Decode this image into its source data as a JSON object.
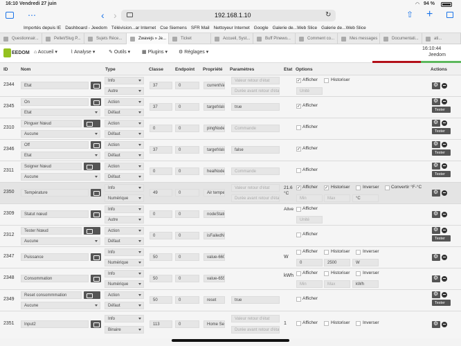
{
  "status": {
    "time": "16:10",
    "date": "Vendredi 27 juin",
    "battery": "94 %"
  },
  "url": {
    "text": "192.168.1.10"
  },
  "bookmarks": [
    "Importés depuis IE",
    "Dashboard - Jeedom",
    "Télévision...ar Internet",
    "Cse Siemens",
    "SFR Mail",
    "Nettoyeur Internet",
    "Google",
    "Galerie de...Web Slice",
    "Galerie de...Web Slice"
  ],
  "tabs": [
    "Questionnair...",
    "Pellet/Slug P...",
    "Sujets Réce...",
    "Zwavejs » Je...",
    "Ticket",
    "Accueil, Syst...",
    "Buff Pinewo...",
    "Comment co...",
    "Mes messages",
    "Documentati...",
    "ati..."
  ],
  "nav": {
    "logo": "EEDOM",
    "accueil": "Accueil",
    "analyse": "Analyse",
    "outils": "Outils",
    "plugins": "Plugins",
    "reglages": "Réglages",
    "clock": "16:10:44",
    "brand": "Jeedom"
  },
  "headers": {
    "id": "ID",
    "nom": "Nom",
    "type": "Type",
    "classe": "Classe",
    "endpoint": "Endpoint",
    "propriete": "Propriété",
    "parametres": "Paramètres",
    "etat": "Etat",
    "options": "Options",
    "actions": "Actions"
  },
  "labels": {
    "afficher": "Afficher",
    "historiser": "Historiser",
    "inverser": "Inverser",
    "convertir": "Convertir °F-°C",
    "tester": "Tester",
    "valeur": "Valeur retour d'état",
    "duree": "Durée avant retour d'état",
    "commande": "Commande",
    "unite": "Unité",
    "min": "Min",
    "max": "Max"
  },
  "rows": [
    {
      "id": "2344",
      "nom": "Etat",
      "t1": "Info",
      "t2": "Autre",
      "classe": "37",
      "endpoint": "0",
      "prop": "currentVa",
      "p1": "",
      "p2": "",
      "etat": "",
      "min": "",
      "max": "",
      "unit": "Unité"
    },
    {
      "id": "2345",
      "nom": "On",
      "sub": "Etat",
      "t1": "Action",
      "t2": "Défaut",
      "classe": "37",
      "endpoint": "0",
      "prop": "targetValu",
      "p1": "true",
      "etat": ""
    },
    {
      "id": "2310",
      "nom": "Pinguer Nœud",
      "sub": "Aucune",
      "t1": "Action",
      "t2": "Défaut",
      "classe": "0",
      "endpoint": "0",
      "prop": "pingNode",
      "p1": "",
      "etat": ""
    },
    {
      "id": "2346",
      "nom": "Off",
      "sub": "Etat",
      "t1": "Action",
      "t2": "Défaut",
      "classe": "37",
      "endpoint": "0",
      "prop": "targetValu",
      "p1": "false",
      "etat": ""
    },
    {
      "id": "2311",
      "nom": "Soigner Nœud",
      "sub": "Aucune",
      "t1": "Action",
      "t2": "Défaut",
      "classe": "0",
      "endpoint": "0",
      "prop": "healNode",
      "p1": "",
      "etat": ""
    },
    {
      "id": "2350",
      "nom": "Température",
      "t1": "Info",
      "t2": "Numérique",
      "classe": "49",
      "endpoint": "0",
      "prop": "Air tempe",
      "etat": "21.6 °C",
      "min": "Min",
      "max": "Max",
      "unit": "°C"
    },
    {
      "id": "2309",
      "nom": "Statut nœud",
      "t1": "Info",
      "t2": "Autre",
      "classe": "0",
      "endpoint": "0",
      "prop": "nodeStatu",
      "etat": "Alive",
      "unit": "Unité"
    },
    {
      "id": "2312",
      "nom": "Tester Nœud",
      "sub": "Aucune",
      "t1": "Action",
      "t2": "Défaut",
      "classe": "0",
      "endpoint": "0",
      "prop": "isFailedNo",
      "etat": ""
    },
    {
      "id": "2347",
      "nom": "Puissance",
      "t1": "Info",
      "t2": "Numérique",
      "classe": "50",
      "endpoint": "0",
      "prop": "value-660",
      "etat": "W",
      "min": "0",
      "max": "2500",
      "unit": "W"
    },
    {
      "id": "2348",
      "nom": "Consommation",
      "t1": "Info",
      "t2": "Numérique",
      "classe": "50",
      "endpoint": "0",
      "prop": "value-655",
      "etat": "kWh",
      "min": "Min",
      "max": "Max",
      "unit": "kWh"
    },
    {
      "id": "2349",
      "nom": "Reset consommmation",
      "sub": "Aucune",
      "t1": "Action",
      "t2": "Défaut",
      "classe": "50",
      "endpoint": "0",
      "prop": "reset",
      "p1": "true",
      "etat": ""
    },
    {
      "id": "2351",
      "nom": "Input2",
      "t1": "Info",
      "t2": "Binaire",
      "classe": "113",
      "endpoint": "0",
      "prop": "Home Secu",
      "etat": "1"
    }
  ]
}
